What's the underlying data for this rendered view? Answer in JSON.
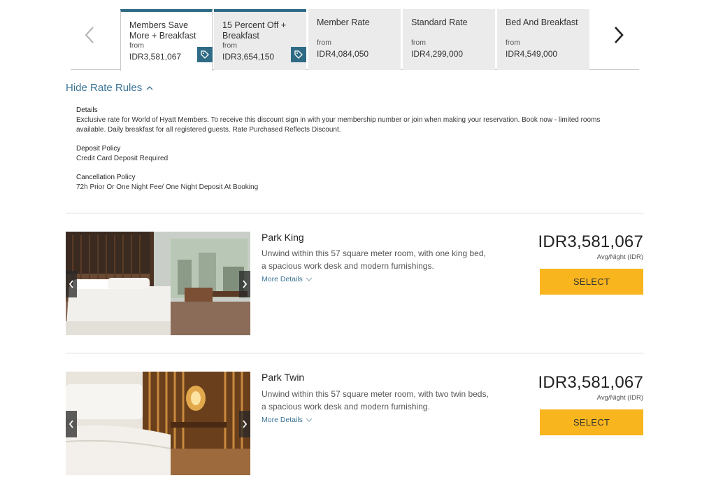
{
  "rate_tabs": [
    {
      "name": "Members Save More + Breakfast",
      "from": "from",
      "price": "IDR3,581,067",
      "has_tag": true
    },
    {
      "name": "15 Percent Off + Breakfast",
      "from": "from",
      "price": "IDR3,654,150",
      "has_tag": true
    },
    {
      "name": "Member Rate",
      "from": "from",
      "price": "IDR4,084,050",
      "has_tag": false
    },
    {
      "name": "Standard Rate",
      "from": "from",
      "price": "IDR4,299,000",
      "has_tag": false
    },
    {
      "name": "Bed And Breakfast",
      "from": "from",
      "price": "IDR4,549,000",
      "has_tag": false
    }
  ],
  "rules": {
    "toggle_label": "Hide Rate Rules",
    "details_heading": "Details",
    "details_text": "Exclusive rate for World of Hyatt Members. To receive this discount sign in with your membership number or join when making your reservation. Book now - limited rooms available. Daily breakfast for all registered guests. Rate Purchased Reflects Discount.",
    "deposit_heading": "Deposit Policy",
    "deposit_text": "Credit Card Deposit Required",
    "cancel_heading": "Cancellation Policy",
    "cancel_text": "72h Prior Or One Night Fee/ One Night Deposit At Booking"
  },
  "rooms": [
    {
      "name": "Park King",
      "description": "Unwind within this 57 square meter room, with one king bed, a spacious work desk and modern furnishings.",
      "more_label": "More Details",
      "price": "IDR3,581,067",
      "price_note": "Avg/Night (IDR)",
      "select_label": "SELECT"
    },
    {
      "name": "Park Twin",
      "description": "Unwind within this 57 square meter room, with two twin beds, a spacious work desk and modern furnishing.",
      "more_label": "More Details",
      "price": "IDR3,581,067",
      "price_note": "Avg/Night (IDR)",
      "select_label": "SELECT"
    }
  ],
  "colors": {
    "accent": "#2f6b85",
    "link": "#3b7496",
    "button": "#f9b51e",
    "tab_bg": "#ebebeb"
  },
  "icons": [
    "chevron-left-icon",
    "chevron-right-icon",
    "price-tag-icon",
    "chevron-up-icon",
    "chevron-down-icon"
  ]
}
